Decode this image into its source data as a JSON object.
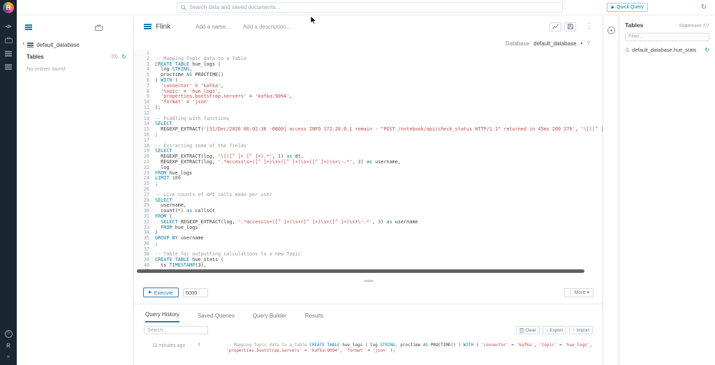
{
  "topbar": {
    "search_placeholder": "Search data and saved documents...",
    "quick_query": "Quick Query"
  },
  "left_nav": {
    "logo_letter": "H",
    "code_glyph": "</>",
    "help": "?",
    "r_label": "R",
    "collapse": "»"
  },
  "assist": {
    "back": "‹",
    "database": "default_database",
    "section_title": "Tables",
    "count": "(0)",
    "empty_message": "No entries found"
  },
  "editor": {
    "dialect": "Flink",
    "name_placeholder": "Add a name...",
    "description_placeholder": "Add a description...",
    "database_label": "Database",
    "database_value": "default_database",
    "help": "?",
    "execute_label": "Execute",
    "limit_value": "5000",
    "more_label": "More",
    "lines": [
      [],
      [
        [
          "c",
          "-- Mapping Topic data to a Table"
        ]
      ],
      [
        [
          "k",
          "CREATE TABLE"
        ],
        [
          "p",
          " hue_logs ("
        ]
      ],
      [
        [
          "p",
          "  log "
        ],
        [
          "k",
          "STRING"
        ],
        [
          "p",
          ","
        ]
      ],
      [
        [
          "p",
          "  proctime "
        ],
        [
          "k",
          "AS"
        ],
        [
          "p",
          " PROCTIME()"
        ]
      ],
      [
        [
          "p",
          ") "
        ],
        [
          "k",
          "WITH"
        ],
        [
          "p",
          " ("
        ]
      ],
      [
        [
          "p",
          "  "
        ],
        [
          "s",
          "'connector'"
        ],
        [
          "p",
          " = "
        ],
        [
          "s",
          "'kafka'"
        ],
        [
          "p",
          ","
        ]
      ],
      [
        [
          "p",
          "  "
        ],
        [
          "s",
          "'topic'"
        ],
        [
          "p",
          " = "
        ],
        [
          "s",
          "'hue_logs'"
        ],
        [
          "p",
          ","
        ]
      ],
      [
        [
          "p",
          "  "
        ],
        [
          "s",
          "'properties.bootstrap.servers'"
        ],
        [
          "p",
          " = "
        ],
        [
          "s",
          "'kafka:9094'"
        ],
        [
          "p",
          ","
        ]
      ],
      [
        [
          "p",
          "  "
        ],
        [
          "s",
          "'format'"
        ],
        [
          "p",
          " = "
        ],
        [
          "s",
          "'json'"
        ]
      ],
      [
        [
          "p",
          ");"
        ]
      ],
      [],
      [
        [
          "c",
          "-- Fiddling with functions"
        ]
      ],
      [
        [
          "k",
          "SELECT"
        ]
      ],
      [
        [
          "p",
          "  REGEXP_EXTRACT("
        ],
        [
          "s",
          "'[31/Dec/2020 06:02:36 -0800] access INFO 172.26.0.1 romain - \"POST /notebook/api/check_status HTTP/1.1\" returned in 45ms 200 276'"
        ],
        [
          "p",
          ", "
        ],
        [
          "s",
          "'\\[([^ ]+ [^"
        ]
      ],
      [
        [
          "p",
          ";"
        ]
      ],
      [],
      [
        [
          "c",
          "-- Extracting some of the fields"
        ]
      ],
      [
        [
          "k",
          "SELECT"
        ]
      ],
      [
        [
          "p",
          "  REGEXP_EXTRACT(log, "
        ],
        [
          "s",
          "'\\[([^ ]+ [^ ]+).*'"
        ],
        [
          "p",
          ", "
        ],
        [
          "n",
          "1"
        ],
        [
          "p",
          ") "
        ],
        [
          "k",
          "as"
        ],
        [
          "p",
          " dt,"
        ]
      ],
      [
        [
          "p",
          "  REGEXP_EXTRACT(log, "
        ],
        [
          "s",
          "'.*access\\s+([^ ]+)\\s+([^ ]+)\\s+([^ ]+)\\s+\\-.*'"
        ],
        [
          "p",
          ", "
        ],
        [
          "n",
          "3"
        ],
        [
          "p",
          ") "
        ],
        [
          "k",
          "as"
        ],
        [
          "p",
          " username,"
        ]
      ],
      [
        [
          "p",
          "  log"
        ]
      ],
      [
        [
          "k",
          "FROM"
        ],
        [
          "p",
          " hue_logs"
        ]
      ],
      [
        [
          "k",
          "LIMIT"
        ],
        [
          "p",
          " "
        ],
        [
          "n",
          "100"
        ]
      ],
      [
        [
          "p",
          ";"
        ]
      ],
      [],
      [
        [
          "c",
          "-- Live counts of API calls made per user"
        ]
      ],
      [
        [
          "k",
          "SELECT"
        ]
      ],
      [
        [
          "p",
          "  username,"
        ]
      ],
      [
        [
          "p",
          "  count(*) "
        ],
        [
          "k",
          "as"
        ],
        [
          "p",
          " callsCt"
        ]
      ],
      [
        [
          "k",
          "FROM"
        ],
        [
          "p",
          " ("
        ]
      ],
      [
        [
          "p",
          "  "
        ],
        [
          "k",
          "SELECT"
        ],
        [
          "p",
          " REGEXP_EXTRACT(log, "
        ],
        [
          "s",
          "'.*access\\s+([^ ]+)\\s+([^ ]+)\\s+([^ ]+)\\s+\\-.*'"
        ],
        [
          "p",
          ", "
        ],
        [
          "n",
          "3"
        ],
        [
          "p",
          ") "
        ],
        [
          "k",
          "as"
        ],
        [
          "p",
          " username"
        ]
      ],
      [
        [
          "p",
          "  "
        ],
        [
          "k",
          "FROM"
        ],
        [
          "p",
          " hue_logs"
        ]
      ],
      [
        [
          "p",
          ")"
        ]
      ],
      [
        [
          "k",
          "GROUP BY"
        ],
        [
          "p",
          " username"
        ]
      ],
      [
        [
          "p",
          ";"
        ]
      ],
      [],
      [
        [
          "c",
          "-- Table for outputting calculations to a new Topic"
        ]
      ],
      [
        [
          "k",
          "CREATE TABLE"
        ],
        [
          "p",
          " hue_stats ("
        ]
      ],
      [
        [
          "p",
          "  ts "
        ],
        [
          "k",
          "TIMESTAMP"
        ],
        [
          "p",
          "(3),"
        ]
      ],
      []
    ]
  },
  "tabs": {
    "history": "Query History",
    "saved": "Saved Queries",
    "builder": "Query Builder",
    "results": "Results"
  },
  "history": {
    "search_placeholder": "Search...",
    "clear": "Clear",
    "export": "Export",
    "import": "Import",
    "entry": {
      "time": "11 minutes ago",
      "status": "!",
      "snippet_lines": [
        [
          [
            "c",
            "-- Mapping Topic data to a Table "
          ],
          [
            "k",
            "CREATE TABLE"
          ],
          [
            "p",
            " hue_logs ( log "
          ],
          [
            "k",
            "STRING"
          ],
          [
            "p",
            ", proctime "
          ],
          [
            "k",
            "AS"
          ],
          [
            "p",
            " PROCTIME() ) "
          ],
          [
            "k",
            "WITH"
          ],
          [
            "p",
            " ( "
          ],
          [
            "s",
            "'connector'"
          ],
          [
            "p",
            " = "
          ],
          [
            "s",
            "'kafka'"
          ],
          [
            "p",
            ", "
          ],
          [
            "s",
            "'topic'"
          ],
          [
            "p",
            " = "
          ],
          [
            "s",
            "'hue_logs'"
          ],
          [
            "p",
            ","
          ]
        ],
        [
          [
            "s",
            "'properties.bootstrap.servers'"
          ],
          [
            "p",
            " = "
          ],
          [
            "s",
            "'kafka:9094'"
          ],
          [
            "p",
            ", "
          ],
          [
            "s",
            "'format'"
          ],
          [
            "p",
            " = "
          ],
          [
            "s",
            "'json'"
          ],
          [
            "p",
            " );"
          ]
        ]
      ]
    }
  },
  "right_panel": {
    "title": "Tables",
    "statement_counter": "Statement 7/7",
    "filter_placeholder": "Filter...",
    "item": "default_database.hue_stats"
  },
  "colors": {
    "accent": "#0b7fad",
    "nav_bg": "#1a2733",
    "warning": "#d2691e"
  }
}
